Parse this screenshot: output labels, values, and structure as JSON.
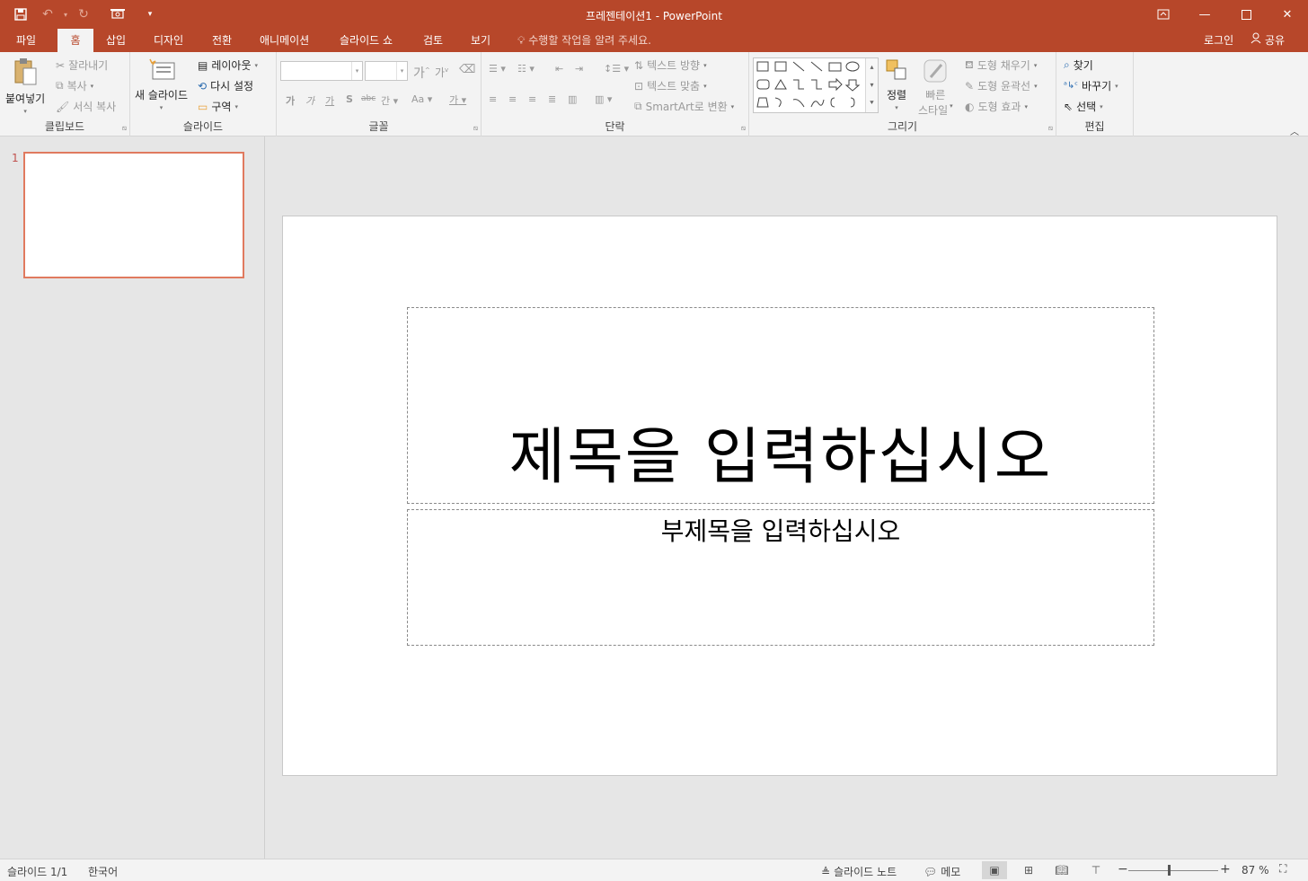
{
  "app": {
    "title": "프레젠테이션1 - PowerPoint"
  },
  "qat": {
    "save": "save-icon",
    "undo": "undo-icon",
    "redo": "redo-icon",
    "slideshow": "slideshow-from-start-icon",
    "customize": "customize-qat-icon"
  },
  "tabs": [
    "파일",
    "홈",
    "삽입",
    "디자인",
    "전환",
    "애니메이션",
    "슬라이드 쇼",
    "검토",
    "보기"
  ],
  "tell_me": "수행할 작업을 알려 주세요.",
  "signin": "로그인",
  "share": "공유",
  "ribbon": {
    "clipboard": {
      "label": "클립보드",
      "paste": "붙여넣기",
      "cut": "잘라내기",
      "copy": "복사",
      "format_painter": "서식 복사"
    },
    "slides": {
      "label": "슬라이드",
      "new_slide": "새 슬라이드",
      "layout": "레이아웃",
      "reset": "다시 설정",
      "section": "구역"
    },
    "font": {
      "label": "글꼴",
      "bold": "가",
      "italic": "가",
      "underline": "가",
      "shadow": "S",
      "strike": "abc",
      "spacing": "간",
      "case": "Aa",
      "color": "가"
    },
    "paragraph": {
      "label": "단락",
      "text_direction": "텍스트 방향",
      "align_text": "텍스트 맞춤",
      "smartart": "SmartArt로 변환"
    },
    "drawing": {
      "label": "그리기",
      "arrange": "정렬",
      "quick_styles_1": "빠른",
      "quick_styles_2": "스타일",
      "shape_fill": "도형 채우기",
      "shape_outline": "도형 윤곽선",
      "shape_effects": "도형 효과"
    },
    "editing": {
      "label": "편집",
      "find": "찾기",
      "replace": "바꾸기",
      "select": "선택"
    }
  },
  "thumbnails": [
    {
      "number": "1"
    }
  ],
  "slide": {
    "title_placeholder": "제목을 입력하십시오",
    "subtitle_placeholder": "부제목을 입력하십시오"
  },
  "status": {
    "slide_info": "슬라이드 1/1",
    "language": "한국어",
    "notes": "슬라이드 노트",
    "comments": "메모",
    "zoom": "87 %",
    "zoom_fraction": 0.45
  },
  "colors": {
    "accent": "#b7472a",
    "ribbon_bg": "#f3f3f3",
    "thumb_border": "#e07a5f"
  }
}
